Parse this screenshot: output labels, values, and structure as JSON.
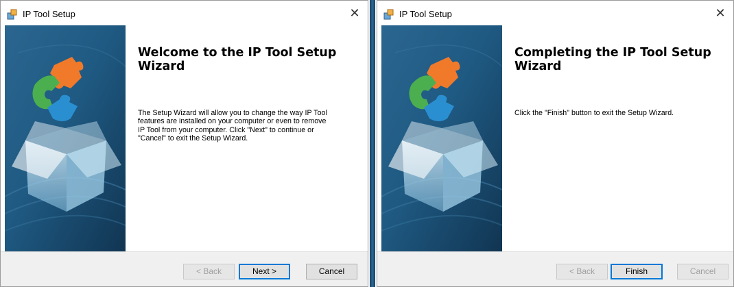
{
  "welcome_window": {
    "title": "IP Tool Setup",
    "heading": "Welcome to the IP Tool Setup Wizard",
    "body": "The Setup Wizard will allow you to change the way IP Tool\nfeatures are installed on your computer or even to remove\nIP Tool from your computer.  Click \"Next\" to continue or\n\"Cancel\" to exit the Setup Wizard.",
    "buttons": {
      "back": "< Back",
      "next": "Next >",
      "cancel": "Cancel"
    }
  },
  "finish_window": {
    "title": "IP Tool Setup",
    "heading": "Completing the IP Tool Setup Wizard",
    "body": "Click the \"Finish\" button to exit the Setup Wizard.",
    "buttons": {
      "back": "< Back",
      "finish": "Finish",
      "cancel": "Cancel"
    }
  },
  "icons": {
    "app": "installer-box-icon",
    "close": "close-icon",
    "banner": "puzzle-box-graphic"
  },
  "colors": {
    "accent_blue": "#0078d7",
    "banner_dark": "#1d4f74",
    "puzzle_orange": "#f07a2a",
    "puzzle_green": "#4caf4f",
    "puzzle_blue": "#2a8fd0"
  }
}
